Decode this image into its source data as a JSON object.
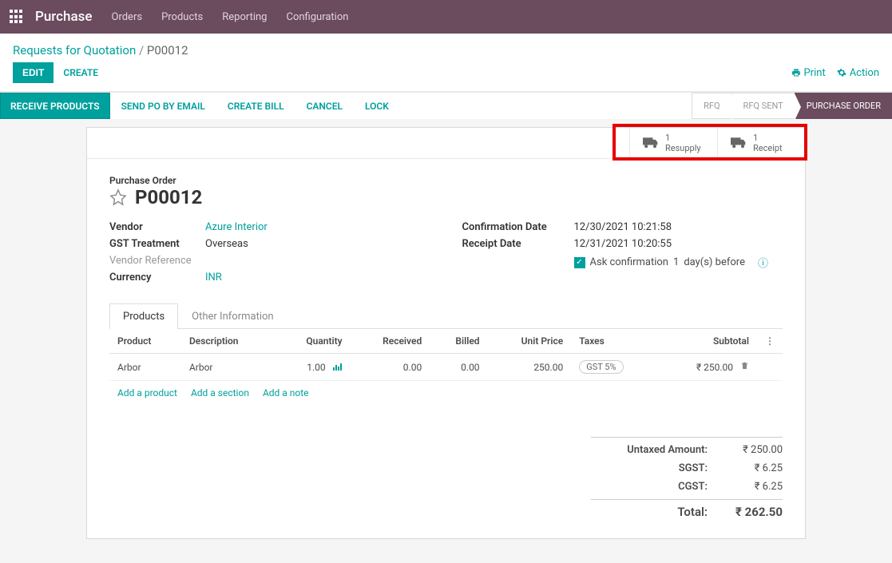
{
  "topbar": {
    "app_name": "Purchase",
    "nav": [
      "Orders",
      "Products",
      "Reporting",
      "Configuration"
    ]
  },
  "breadcrumb": {
    "root": "Requests for Quotation",
    "current": "P00012"
  },
  "actions": {
    "edit": "EDIT",
    "create": "CREATE",
    "print": "Print",
    "action": "Action"
  },
  "buttons": {
    "receive_products": "RECEIVE PRODUCTS",
    "send_po": "SEND PO BY EMAIL",
    "create_bill": "CREATE BILL",
    "cancel": "CANCEL",
    "lock": "LOCK"
  },
  "status": {
    "rfq": "RFQ",
    "rfq_sent": "RFQ SENT",
    "purchase_order": "PURCHASE ORDER"
  },
  "stat_buttons": {
    "resupply_count": "1",
    "resupply_label": "Resupply",
    "receipt_count": "1",
    "receipt_label": "Receipt"
  },
  "sheet": {
    "title_label": "Purchase Order",
    "po_number": "P00012",
    "fields": {
      "vendor_label": "Vendor",
      "vendor_value": "Azure Interior",
      "gst_label": "GST Treatment",
      "gst_value": "Overseas",
      "vendor_ref_label": "Vendor Reference",
      "currency_label": "Currency",
      "currency_value": "INR",
      "conf_date_label": "Confirmation Date",
      "conf_date_value": "12/30/2021 10:21:58",
      "receipt_date_label": "Receipt Date",
      "receipt_date_value": "12/31/2021 10:20:55",
      "ask_conf_text": "Ask confirmation",
      "ask_conf_days": "1",
      "ask_conf_unit": "day(s) before"
    }
  },
  "tabs": {
    "products": "Products",
    "other_info": "Other Information"
  },
  "grid": {
    "headers": {
      "product": "Product",
      "description": "Description",
      "quantity": "Quantity",
      "received": "Received",
      "billed": "Billed",
      "unit_price": "Unit Price",
      "taxes": "Taxes",
      "subtotal": "Subtotal"
    },
    "rows": [
      {
        "product": "Arbor",
        "description": "Arbor",
        "quantity": "1.00",
        "received": "0.00",
        "billed": "0.00",
        "unit_price": "250.00",
        "taxes": "GST 5%",
        "subtotal": "₹ 250.00"
      }
    ],
    "add_product": "Add a product",
    "add_section": "Add a section",
    "add_note": "Add a note"
  },
  "totals": {
    "untaxed_label": "Untaxed Amount:",
    "untaxed_value": "₹ 250.00",
    "sgst_label": "SGST:",
    "sgst_value": "₹ 6.25",
    "cgst_label": "CGST:",
    "cgst_value": "₹ 6.25",
    "total_label": "Total:",
    "total_value": "₹ 262.50"
  }
}
